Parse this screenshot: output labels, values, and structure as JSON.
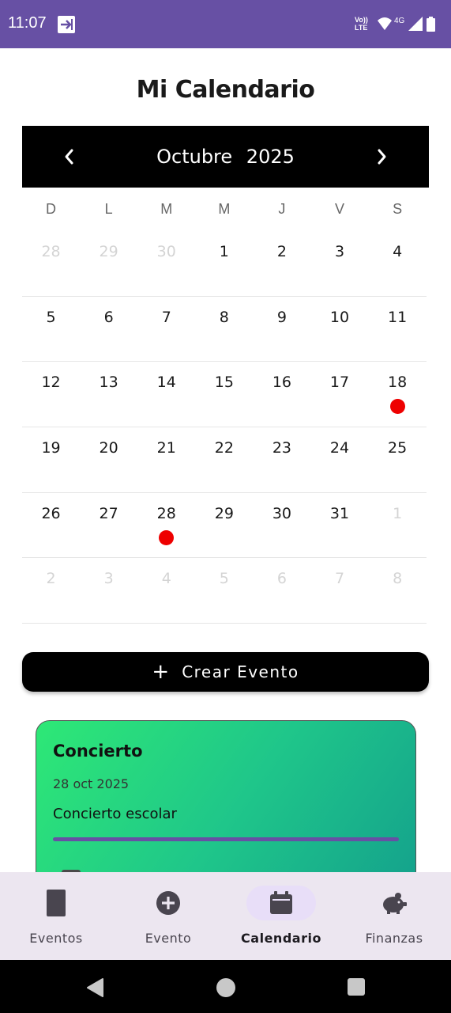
{
  "status_bar": {
    "time": "11:07",
    "network_label_top": "Vo))",
    "network_label_bottom": "LTE",
    "network_type": "4G",
    "icons": [
      "cast-icon",
      "volte-icon",
      "wifi-icon",
      "signal-icon",
      "battery-icon"
    ]
  },
  "page_title": "Mi Calendario",
  "calendar": {
    "month": "Octubre",
    "year": "2025",
    "weekdays": [
      "D",
      "L",
      "M",
      "M",
      "J",
      "V",
      "S"
    ],
    "event_dot_color": "#ee0000",
    "weeks": [
      [
        {
          "d": "28",
          "m": true
        },
        {
          "d": "29",
          "m": true
        },
        {
          "d": "30",
          "m": true
        },
        {
          "d": "1"
        },
        {
          "d": "2"
        },
        {
          "d": "3"
        },
        {
          "d": "4"
        }
      ],
      [
        {
          "d": "5"
        },
        {
          "d": "6"
        },
        {
          "d": "7"
        },
        {
          "d": "8"
        },
        {
          "d": "9"
        },
        {
          "d": "10"
        },
        {
          "d": "11"
        }
      ],
      [
        {
          "d": "12"
        },
        {
          "d": "13"
        },
        {
          "d": "14"
        },
        {
          "d": "15"
        },
        {
          "d": "16"
        },
        {
          "d": "17"
        },
        {
          "d": "18",
          "ev": true
        }
      ],
      [
        {
          "d": "19"
        },
        {
          "d": "20"
        },
        {
          "d": "21"
        },
        {
          "d": "22"
        },
        {
          "d": "23"
        },
        {
          "d": "24"
        },
        {
          "d": "25"
        }
      ],
      [
        {
          "d": "26"
        },
        {
          "d": "27"
        },
        {
          "d": "28",
          "ev": true
        },
        {
          "d": "29"
        },
        {
          "d": "30"
        },
        {
          "d": "31"
        },
        {
          "d": "1",
          "m": true
        }
      ],
      [
        {
          "d": "2",
          "m": true
        },
        {
          "d": "3",
          "m": true
        },
        {
          "d": "4",
          "m": true
        },
        {
          "d": "5",
          "m": true
        },
        {
          "d": "6",
          "m": true
        },
        {
          "d": "7",
          "m": true
        },
        {
          "d": "8",
          "m": true
        }
      ]
    ]
  },
  "create_button": {
    "icon": "plus-icon",
    "label": "Crear Evento"
  },
  "event_card": {
    "title": "Concierto",
    "date": "28 oct 2025",
    "description": "Concierto escolar",
    "accent_color": "#6750a4"
  },
  "bottom_nav": {
    "items": [
      {
        "label": "Eventos",
        "icon": "book-icon",
        "active": false
      },
      {
        "label": "Evento",
        "icon": "add-circle-icon",
        "active": false
      },
      {
        "label": "Calendario",
        "icon": "calendar-icon",
        "active": true
      },
      {
        "label": "Finanzas",
        "icon": "piggy-bank-icon",
        "active": false
      }
    ]
  },
  "colors": {
    "primary": "#6750a4",
    "nav_background": "#ece6f0",
    "nav_active_pill": "#e8def8"
  }
}
